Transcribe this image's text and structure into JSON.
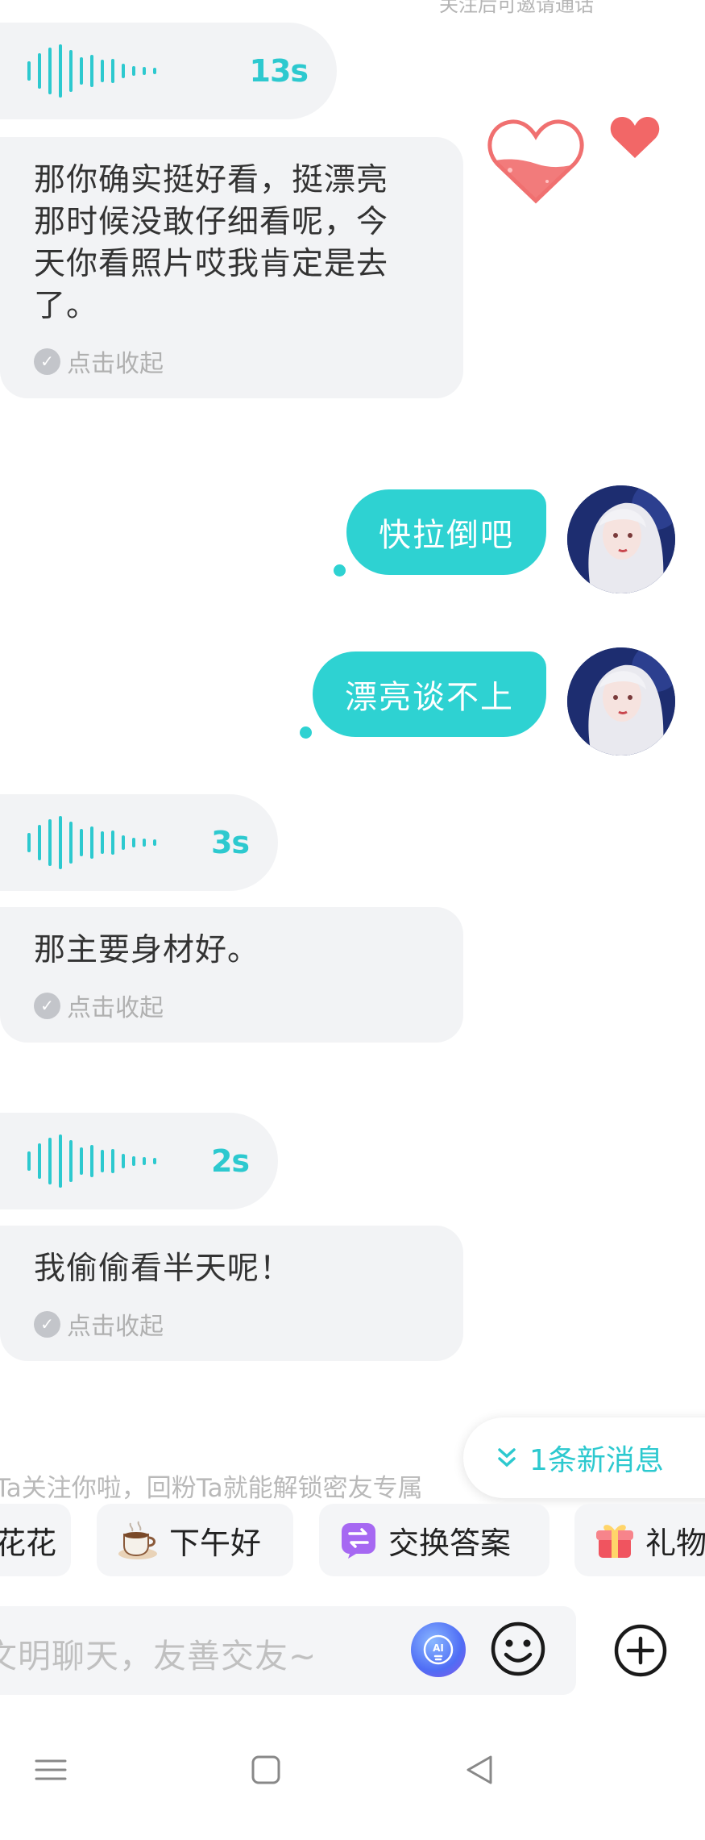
{
  "top_hint": "关注后可邀请通话",
  "messages": {
    "voice_1": {
      "duration": "13s"
    },
    "text_1": {
      "text": "那你确实挺好看，挺漂亮那时候没敢仔细看呢，今天你看照片哎我肯定是去了。",
      "collapse": "点击收起"
    },
    "out_1": {
      "text": "快拉倒吧"
    },
    "out_2": {
      "text": "漂亮谈不上"
    },
    "voice_2": {
      "duration": "3s"
    },
    "text_2": {
      "text": "那主要身材好。",
      "collapse": "点击收起"
    },
    "voice_3": {
      "duration": "2s"
    },
    "text_3": {
      "text": "我偷偷看半天呢！",
      "collapse": "点击收起"
    }
  },
  "notice": "Ta关注你啦，回粉Ta就能解锁密友专属",
  "new_messages": "1条新消息",
  "quick_replies": [
    "花花",
    "下午好",
    "交换答案",
    "礼物"
  ],
  "input": {
    "placeholder": "文明聊天，友善交友~",
    "ai_label": "AI"
  },
  "colors": {
    "accent": "#2dc9cf",
    "bubble_in": "#f2f3f5",
    "bubble_out": "#2ed2d2"
  },
  "icons": [
    "waveform-icon",
    "check-circle-icon",
    "heart-jar-icon",
    "heart-icon",
    "chevron-double-down-icon",
    "flower-icon",
    "coffee-icon",
    "swap-icon",
    "gift-icon",
    "ai-icon",
    "emoji-icon",
    "plus-circle-icon",
    "menu-icon",
    "home-square-icon",
    "back-triangle-icon"
  ]
}
